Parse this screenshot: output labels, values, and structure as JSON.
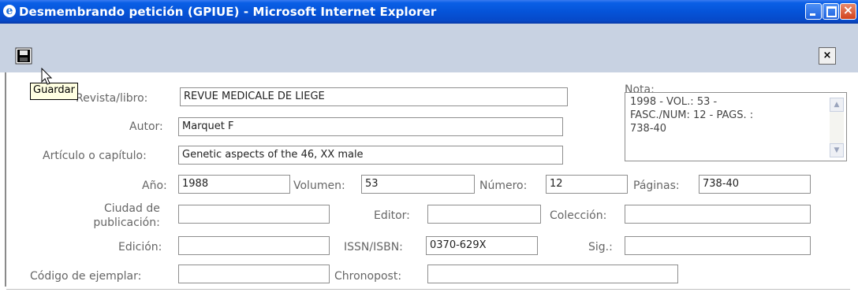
{
  "window": {
    "title": "Desmembrando petición (GPIUE) - Microsoft Internet Explorer"
  },
  "toolbar": {
    "tooltip": "Guardar",
    "close_symbol": "×"
  },
  "form": {
    "revista_label": "Revista/libro:",
    "revista_value": "REVUE MEDICALE DE LIEGE",
    "autor_label": "Autor:",
    "autor_value": "Marquet F",
    "articulo_label": "Artículo o capítulo:",
    "articulo_value": "Genetic aspects of the 46, XX male",
    "nota_label": "Nota:",
    "nota_value": "1998 - VOL.: 53 -\nFASC./NUM: 12 - PAGS. :\n738-40",
    "anio_label": "Año:",
    "anio_value": "1988",
    "volumen_label": "Volumen:",
    "volumen_value": "53",
    "numero_label": "Número:",
    "numero_value": "12",
    "paginas_label": "Páginas:",
    "paginas_value": "738-40",
    "ciudad_label_1": "Ciudad de",
    "ciudad_label_2": "publicación:",
    "ciudad_value": "",
    "editor_label": "Editor:",
    "editor_value": "",
    "coleccion_label": "Colección:",
    "coleccion_value": "",
    "edicion_label": "Edición:",
    "edicion_value": "",
    "issn_label": "ISSN/ISBN:",
    "issn_value": "0370-629X",
    "sig_label": "Sig.:",
    "sig_value": "",
    "codigo_label": "Código de ejemplar:",
    "codigo_value": "",
    "chronopost_label": "Chronopost:",
    "chronopost_value": ""
  },
  "icons": {
    "window": "ie-icon",
    "save": "floppy-disk-icon",
    "close": "close-icon"
  }
}
